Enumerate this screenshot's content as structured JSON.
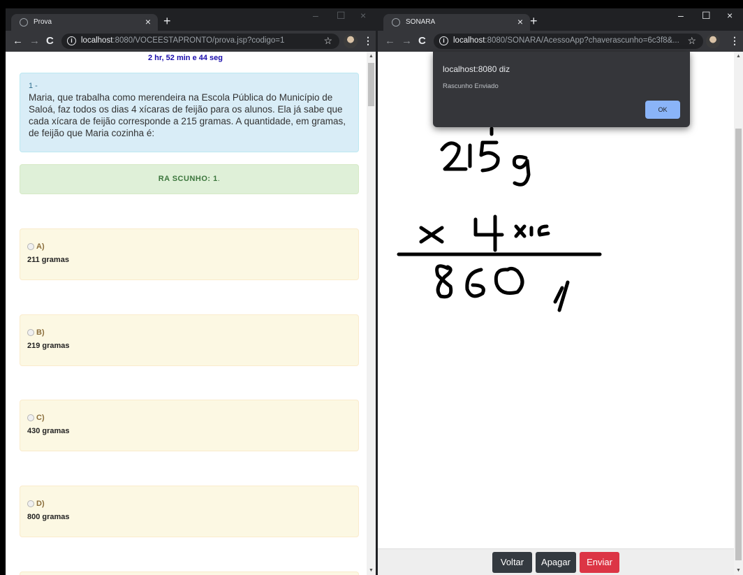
{
  "left_window": {
    "tab_title": "Prova",
    "url_host": "localhost",
    "url_rest": ":8080/VOCEESTAPRONTO/prova.jsp?codigo=1",
    "timer": "2 hr, 52 min e 44 seg",
    "question": {
      "number": "1 -",
      "text": "Maria, que trabalha como merendeira na Escola Pública do Município de Saloá, faz todos os dias 4 xícaras de feijão para os alunos. Ela já sabe que cada xícara de feijão corresponde a 215 gramas. A quantidade, em gramas, de feijão que Maria cozinha é:"
    },
    "rascunho_label": "RA SCUNHO: 1",
    "options": [
      {
        "letter": "A)",
        "text": "211 gramas"
      },
      {
        "letter": "B)",
        "text": "219 gramas"
      },
      {
        "letter": "C)",
        "text": "430 gramas"
      },
      {
        "letter": "D)",
        "text": "800 gramas"
      }
    ]
  },
  "right_window": {
    "tab_title": "SONARA",
    "url_host": "localhost",
    "url_rest": ":8080/SONARA/AcessoApp?chaverascunho=6c3f8&...",
    "dialog": {
      "title": "localhost:8080 diz",
      "message": "Rascunho Enviado",
      "ok_label": "OK"
    },
    "buttons": {
      "voltar": "Voltar",
      "apagar": "Apagar",
      "enviar": "Enviar"
    }
  },
  "icons": {
    "close": "×",
    "newtab": "+",
    "back": "←",
    "forward": "→",
    "reload": "C",
    "info": "i",
    "star": "☆",
    "menu": "⋮",
    "minimize": "–",
    "maximize": "☐",
    "scroll_up": "▲",
    "scroll_down": "▼"
  }
}
